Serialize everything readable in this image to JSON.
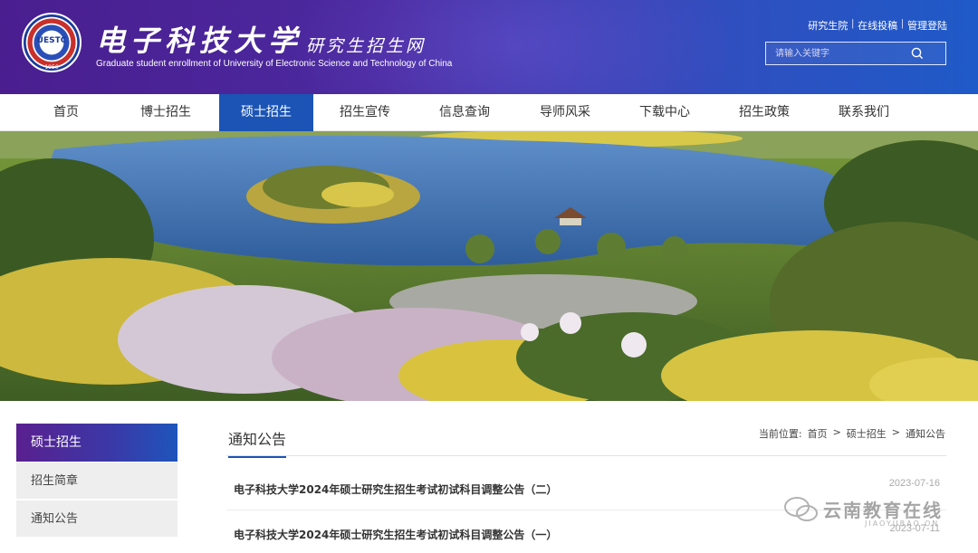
{
  "header": {
    "logo_text": "UESTC",
    "logo_year": "1956",
    "title_cn": "电子科技大学",
    "subtitle_cn": "研究生招生网",
    "title_en": "Graduate student enrollment of University of Electronic Science and Technology of China",
    "top_links": [
      "研究生院",
      "在线投稿",
      "管理登陆"
    ],
    "search_placeholder": "请输入关键字"
  },
  "nav": {
    "items": [
      "首页",
      "博士招生",
      "硕士招生",
      "招生宣传",
      "信息查询",
      "导师风采",
      "下载中心",
      "招生政策",
      "联系我们"
    ],
    "active_index": 2
  },
  "sidebar": {
    "heading": "硕士招生",
    "items": [
      "招生简章",
      "通知公告"
    ]
  },
  "content": {
    "section_title": "通知公告",
    "breadcrumb": {
      "label": "当前位置:",
      "items": [
        "首页",
        "硕士招生",
        "通知公告"
      ],
      "separator": ">"
    },
    "news": [
      {
        "title": "电子科技大学2024年硕士研究生招生考试初试科目调整公告（二）",
        "date": "2023-07-16"
      },
      {
        "title": "电子科技大学2024年硕士研究生招生考试初试科目调整公告（一）",
        "date": "2023-07-11"
      }
    ]
  },
  "watermark": {
    "cn": "云南教育在线",
    "en": "JIAOYUBAO.ON"
  },
  "colors": {
    "accent": "#1b54b5",
    "header_start": "#4a1e8f",
    "header_end": "#1f5ac8"
  }
}
